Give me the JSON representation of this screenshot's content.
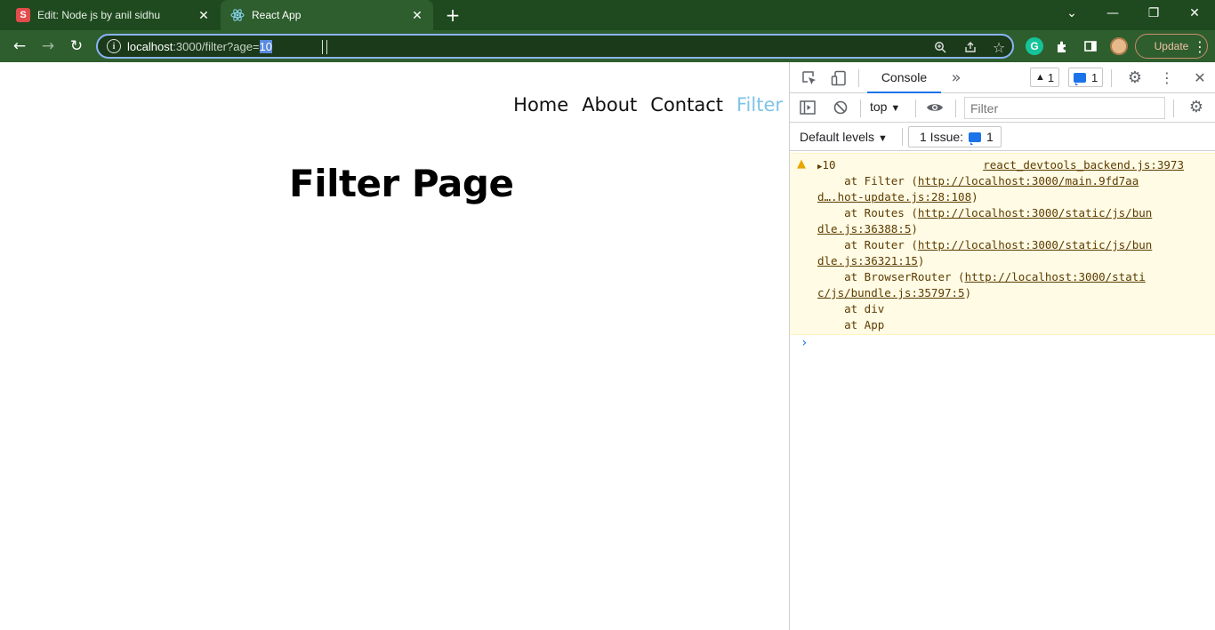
{
  "tabs": [
    {
      "title": "Edit: Node js by anil sidhu",
      "favicon": "S",
      "close": "✕"
    },
    {
      "title": "React App",
      "favicon": "⚛",
      "close": "✕"
    }
  ],
  "window": {
    "new_tab": "+",
    "tab_search": "⌄",
    "minimize": "—",
    "restore": "❐",
    "close": "✕"
  },
  "toolbar": {
    "back": "←",
    "forward": "→",
    "reload": "↻",
    "url_host": "localhost",
    "url_rest": ":3000/filter?age=",
    "url_selected": "10",
    "update_label": "Update",
    "menu": "⋮"
  },
  "page": {
    "nav": [
      "Home",
      "About",
      "Contact",
      "Filter"
    ],
    "active_nav": "Filter",
    "heading": "Filter Page"
  },
  "devtools": {
    "tab_console": "Console",
    "more_tabs": "»",
    "warnings_count": "1",
    "messages_count": "1",
    "context": "top",
    "filter_placeholder": "Filter",
    "default_levels": "Default levels",
    "issues_label": "1 Issue:",
    "issues_count": "1",
    "log": {
      "value": "10",
      "source": "react_devtools_backend.js:3973",
      "lines": [
        {
          "prefix": "    at Filter (",
          "link": "http://localhost:3000/main.9fd7aa",
          "suffix": ""
        },
        {
          "prefix": "",
          "link": "d….hot-update.js:28:108",
          "suffix": ")"
        },
        {
          "prefix": "    at Routes (",
          "link": "http://localhost:3000/static/js/bun",
          "suffix": ""
        },
        {
          "prefix": "",
          "link": "dle.js:36388:5",
          "suffix": ")"
        },
        {
          "prefix": "    at Router (",
          "link": "http://localhost:3000/static/js/bun",
          "suffix": ""
        },
        {
          "prefix": "",
          "link": "dle.js:36321:15",
          "suffix": ")"
        },
        {
          "prefix": "    at BrowserRouter (",
          "link": "http://localhost:3000/stati",
          "suffix": ""
        },
        {
          "prefix": "",
          "link": "c/js/bundle.js:35797:5",
          "suffix": ")"
        },
        {
          "prefix": "    at div",
          "link": "",
          "suffix": ""
        },
        {
          "prefix": "    at App",
          "link": "",
          "suffix": ""
        }
      ]
    },
    "prompt": "›"
  },
  "colors": {
    "tabbar_bg": "#1f4a1f",
    "toolbar_bg": "#2e5e2e",
    "nav_active": "#7fc4e8",
    "devtools_accent": "#1a73e8",
    "warning_bg": "#fffbe5"
  }
}
